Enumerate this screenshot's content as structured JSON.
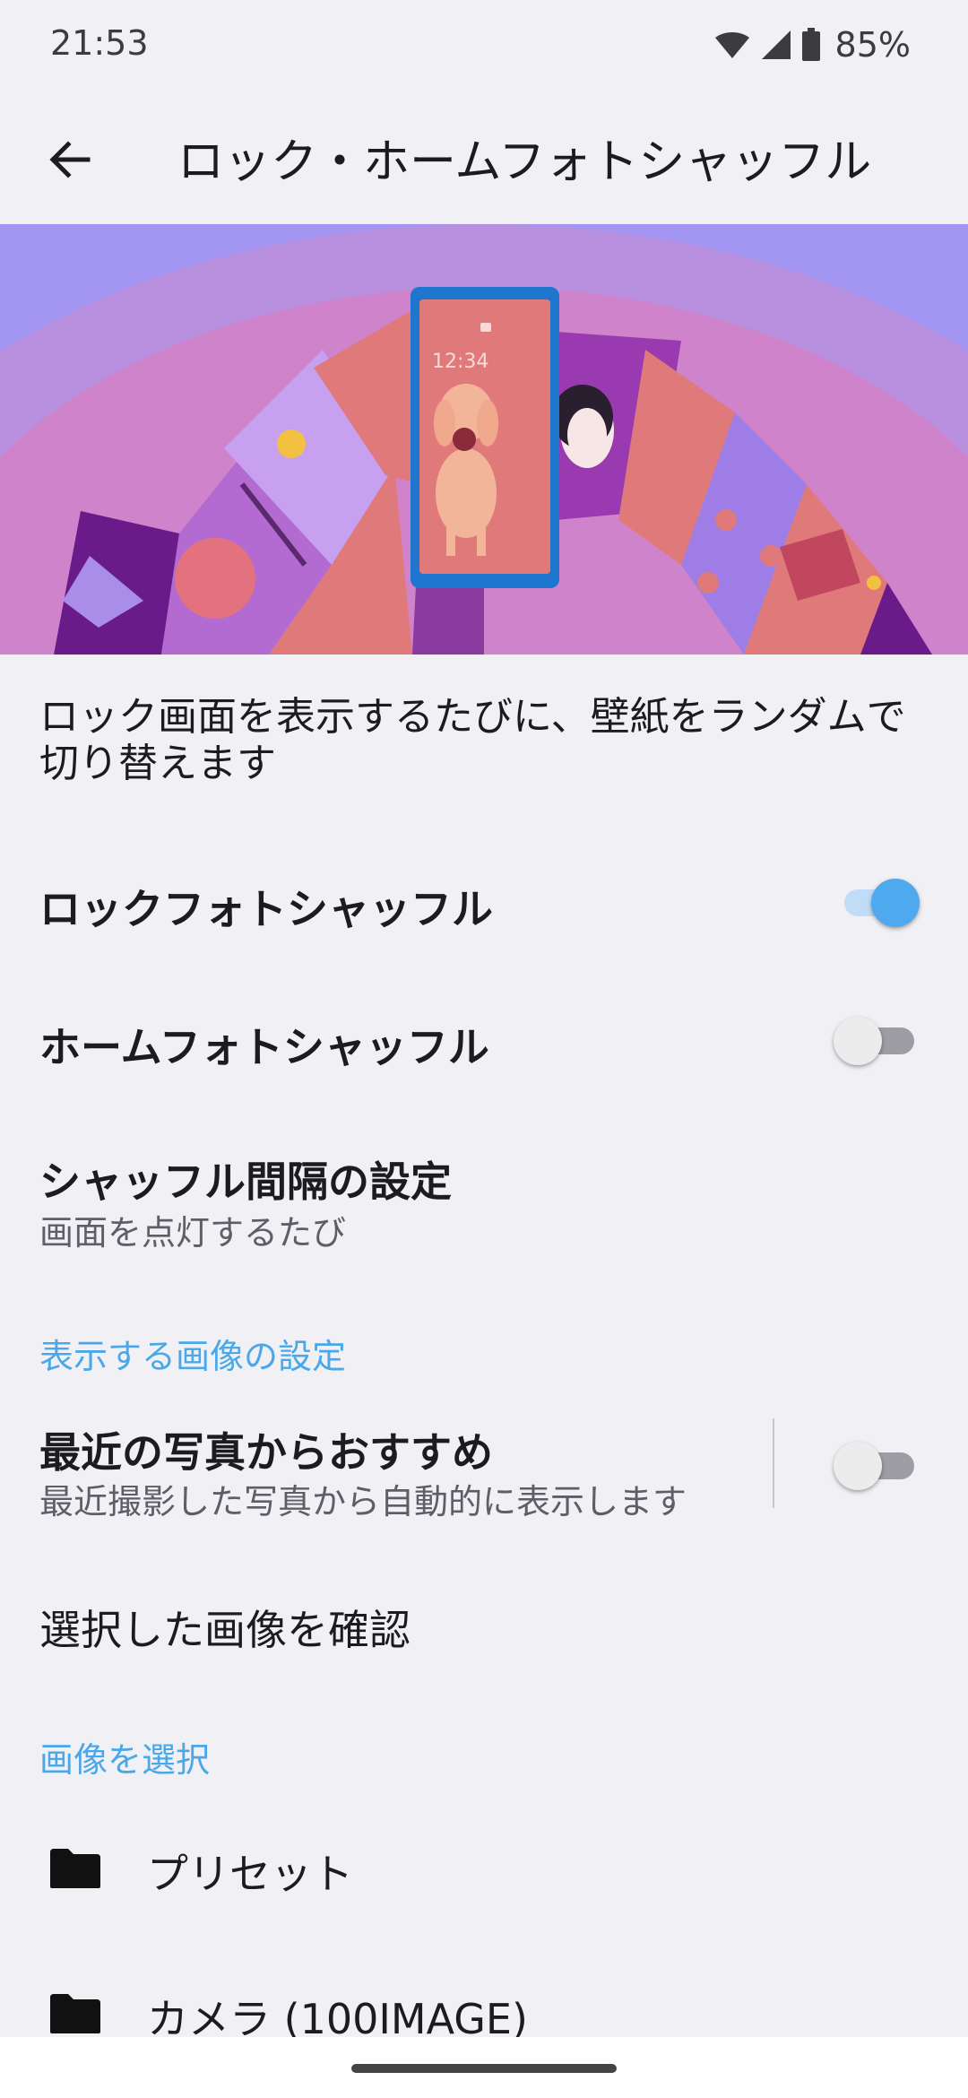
{
  "status_bar": {
    "time": "21:53",
    "battery": "85%",
    "icons": [
      "wifi-icon",
      "signal-icon",
      "battery-icon"
    ]
  },
  "app_bar": {
    "title": "ロック・ホームフォトシャッフル",
    "back_icon": "arrow-left-icon"
  },
  "hero": {
    "phone_clock": "12:34"
  },
  "description": "ロック画面を表示するたびに、壁紙をランダムで切り替えます",
  "settings": {
    "lock_shuffle": {
      "label": "ロックフォトシャッフル",
      "enabled": true
    },
    "home_shuffle": {
      "label": "ホームフォトシャッフル",
      "enabled": false
    },
    "interval": {
      "label": "シャッフル間隔の設定",
      "value": "画面を点灯するたび"
    }
  },
  "image_settings": {
    "header": "表示する画像の設定",
    "recent": {
      "label": "最近の写真からおすすめ",
      "summary": "最近撮影した写真から自動的に表示します",
      "enabled": false
    },
    "confirm_label": "選択した画像を確認"
  },
  "select_images": {
    "header": "画像を選択",
    "folders": [
      {
        "label": "プリセット",
        "icon": "folder-icon"
      },
      {
        "label": "カメラ (100IMAGE)",
        "icon": "folder-icon"
      }
    ]
  },
  "colors": {
    "accent": "#4fa9ef",
    "section_header": "#4aa8e8",
    "background": "#f1f0f5"
  }
}
